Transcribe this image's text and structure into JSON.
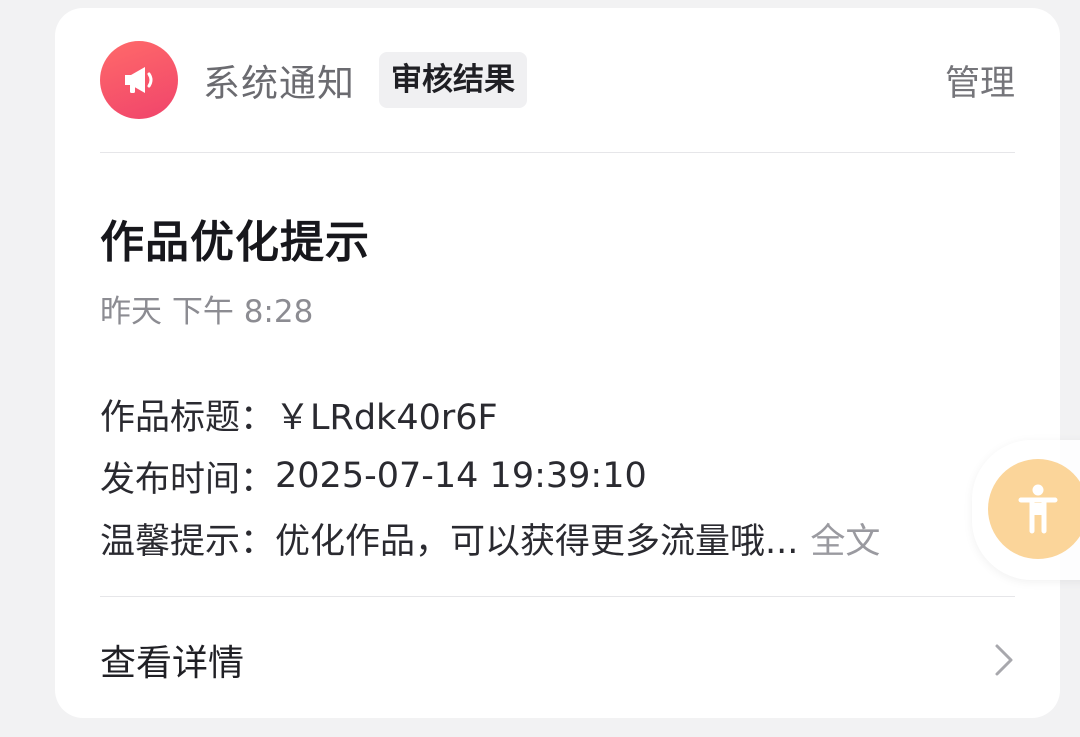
{
  "header": {
    "sender": "系统通知",
    "tag": "审核结果",
    "manage": "管理",
    "avatar_icon": "megaphone-icon",
    "avatar_color": "#f0446b"
  },
  "notice": {
    "title": "作品优化提示",
    "time": "昨天 下午 8:28",
    "fields": [
      {
        "label": "作品标题：",
        "value": "￥LRdk40r6F"
      },
      {
        "label": "发布时间：",
        "value": "2025-07-14 19:39:10"
      },
      {
        "label": "温馨提示：",
        "value": "优化作品，可以获得更多流量哦...",
        "more": "全文"
      }
    ]
  },
  "footer": {
    "detail_label": "查看详情",
    "chevron_icon": "chevron-right-icon"
  },
  "floating": {
    "icon": "accessibility-person-icon",
    "color": "#fbd59a"
  }
}
